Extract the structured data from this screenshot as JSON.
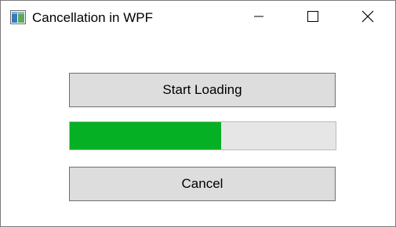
{
  "window": {
    "title": "Cancellation in WPF",
    "icon": "wpf-app-icon"
  },
  "caption_buttons": {
    "minimize_icon": "minimize-icon",
    "maximize_icon": "maximize-icon",
    "close_icon": "close-icon"
  },
  "main": {
    "start_label": "Start Loading",
    "cancel_label": "Cancel",
    "progress": {
      "value": 0.57,
      "fill_color": "#06b025",
      "track_color": "#e6e6e6"
    }
  }
}
